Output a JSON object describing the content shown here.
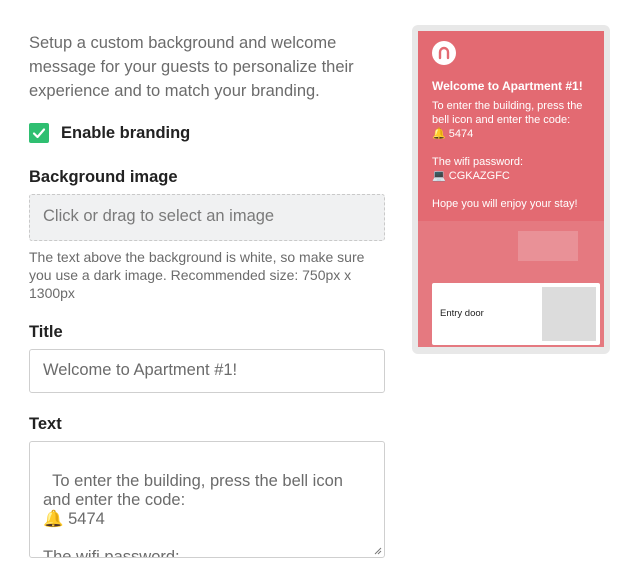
{
  "intro": {
    "text": "Setup a custom background and welcome message for your guests to personalize their experience and to match your branding."
  },
  "branding": {
    "label": "Enable branding",
    "checked": true
  },
  "background": {
    "label": "Background image",
    "dropzone_text": "Click or drag to select an image",
    "hint": "The text above the background is white, so make sure you use a dark image. Recommended size: 750px x 1300px"
  },
  "title_field": {
    "label": "Title",
    "value": "Welcome to Apartment #1!"
  },
  "text_field": {
    "label": "Text",
    "value": "To enter the building, press the bell icon and enter the code:\n🔔 5474\n\nThe wifi password:\n💻 CGKAZGFC"
  },
  "preview": {
    "title": "Welcome to Apartment #1!",
    "text": "To enter the building, press the bell icon and enter the code:\n🔔 5474\n\nThe wifi password:\n💻 CGKAZGFC\n\nHope you will enjoy your stay!",
    "card_label": "Entry door",
    "logo_icon": "brand-logo-icon",
    "overlay_color": "#e36a72"
  },
  "colors": {
    "accent": "#2fbf71"
  }
}
